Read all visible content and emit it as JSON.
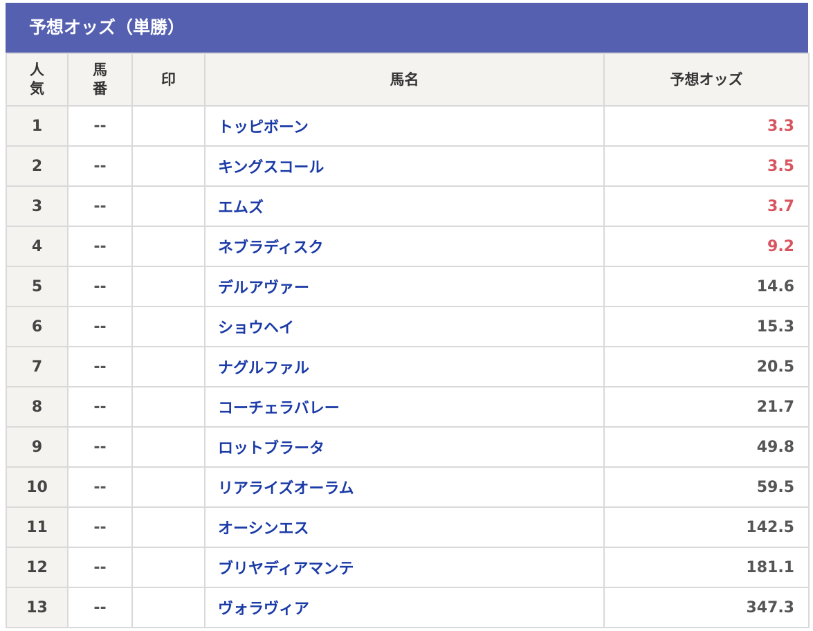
{
  "title": "予想オッズ（単勝）",
  "headers": {
    "popularity": [
      "人",
      "気"
    ],
    "horse_number": [
      "馬",
      "番"
    ],
    "mark": "印",
    "horse_name": "馬名",
    "odds": "予想オッズ"
  },
  "colors": {
    "header_bar": "#5560b0",
    "horse_name": "#1a3aa6",
    "favored_odds": "#d8555f",
    "normal_odds": "#555555"
  },
  "rows": [
    {
      "pop": "1",
      "num": "--",
      "mark": "",
      "name": "トッピボーン",
      "odds": "3.3",
      "fav": true
    },
    {
      "pop": "2",
      "num": "--",
      "mark": "",
      "name": "キングスコール",
      "odds": "3.5",
      "fav": true
    },
    {
      "pop": "3",
      "num": "--",
      "mark": "",
      "name": "エムズ",
      "odds": "3.7",
      "fav": true
    },
    {
      "pop": "4",
      "num": "--",
      "mark": "",
      "name": "ネブラディスク",
      "odds": "9.2",
      "fav": true
    },
    {
      "pop": "5",
      "num": "--",
      "mark": "",
      "name": "デルアヴァー",
      "odds": "14.6",
      "fav": false
    },
    {
      "pop": "6",
      "num": "--",
      "mark": "",
      "name": "ショウヘイ",
      "odds": "15.3",
      "fav": false
    },
    {
      "pop": "7",
      "num": "--",
      "mark": "",
      "name": "ナグルファル",
      "odds": "20.5",
      "fav": false
    },
    {
      "pop": "8",
      "num": "--",
      "mark": "",
      "name": "コーチェラバレー",
      "odds": "21.7",
      "fav": false
    },
    {
      "pop": "9",
      "num": "--",
      "mark": "",
      "name": "ロットブラータ",
      "odds": "49.8",
      "fav": false
    },
    {
      "pop": "10",
      "num": "--",
      "mark": "",
      "name": "リアライズオーラム",
      "odds": "59.5",
      "fav": false
    },
    {
      "pop": "11",
      "num": "--",
      "mark": "",
      "name": "オーシンエス",
      "odds": "142.5",
      "fav": false
    },
    {
      "pop": "12",
      "num": "--",
      "mark": "",
      "name": "ブリヤディアマンテ",
      "odds": "181.1",
      "fav": false
    },
    {
      "pop": "13",
      "num": "--",
      "mark": "",
      "name": "ヴォラヴィア",
      "odds": "347.3",
      "fav": false
    }
  ]
}
